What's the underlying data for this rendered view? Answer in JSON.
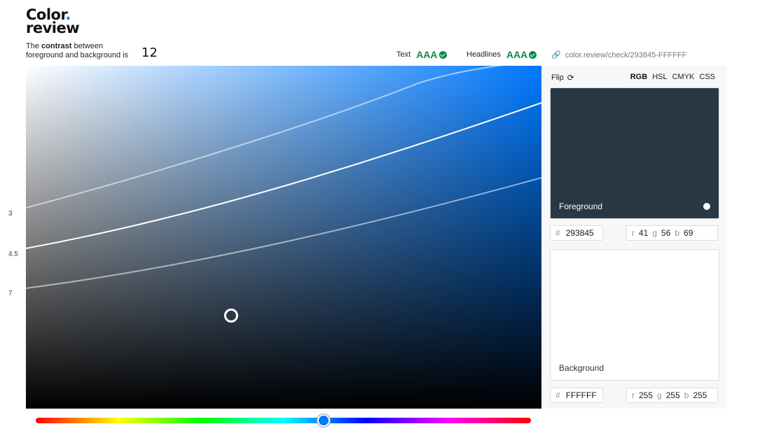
{
  "logo": {
    "line1": "Color",
    "dot": ".",
    "line2": "review"
  },
  "summary": {
    "prefix": "The ",
    "bold": "contrast",
    "rest1": " between",
    "rest2": "foreground and background is",
    "value": "12"
  },
  "badges": {
    "text": {
      "label": "Text",
      "grade": "AAA"
    },
    "headlines": {
      "label": "Headlines",
      "grade": "AAA"
    }
  },
  "permalink": "color.review/check/293845-FFFFFF",
  "ratio_labels": [
    "3",
    "4.5",
    "7"
  ],
  "panel": {
    "flip_label": "Flip",
    "modes": [
      "RGB",
      "HSL",
      "CMYK",
      "CSS"
    ],
    "active_mode": "RGB",
    "foreground": {
      "label": "Foreground",
      "hex": "293845",
      "r": "41",
      "g": "56",
      "b": "69",
      "color": "#293845"
    },
    "background": {
      "label": "Background",
      "hex": "FFFFFF",
      "r": "255",
      "g": "255",
      "b": "255",
      "color": "#FFFFFF"
    }
  },
  "hue": {
    "value_deg": 212
  },
  "colors": {
    "accent": "#0079ff",
    "pass": "#0a8a4a"
  },
  "icons": {
    "check": "check-circle-icon",
    "link": "link-icon",
    "flip": "refresh-icon"
  }
}
